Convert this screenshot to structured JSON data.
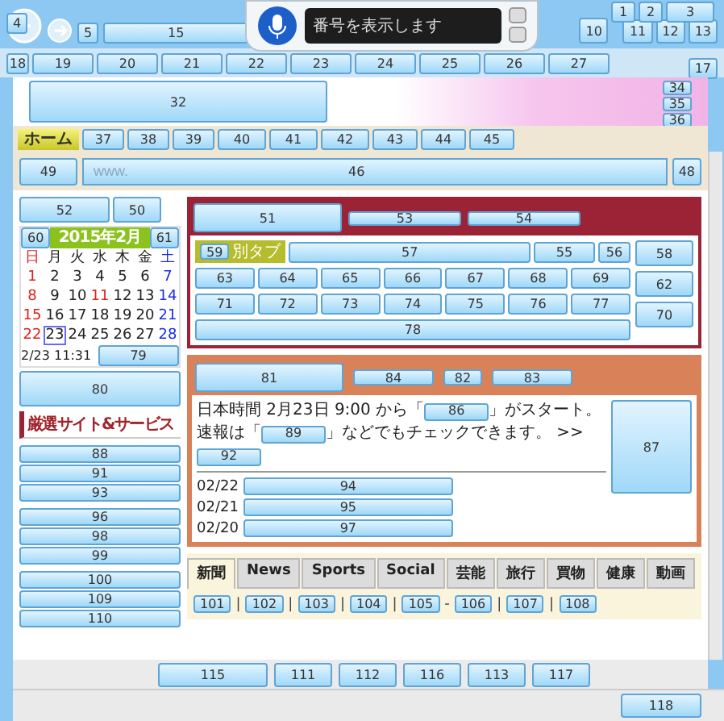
{
  "speech": {
    "status": "番号を表示します"
  },
  "window_tags": [
    "1",
    "2",
    "3"
  ],
  "nav": {
    "back_tag": "4",
    "small_tag": "5",
    "address_tag": "15",
    "tab_tag": "10",
    "right_tags": [
      "11",
      "12",
      "13"
    ]
  },
  "favorites": [
    "18",
    "19",
    "20",
    "21",
    "22",
    "23",
    "24",
    "25",
    "26",
    "27"
  ],
  "favorites_end_tag": "17",
  "header": {
    "banner_tag": "32",
    "side_tags": [
      "34",
      "35",
      "36"
    ]
  },
  "menu": {
    "home": "ホーム",
    "tags": [
      "37",
      "38",
      "39",
      "40",
      "41",
      "42",
      "43",
      "44",
      "45"
    ]
  },
  "url_row": {
    "select_tag": "49",
    "placeholder": "www.",
    "url_tag": "46",
    "go_tag": "48"
  },
  "left": {
    "shop_tags": [
      "52",
      "50"
    ],
    "calendar": {
      "title": "2015年2月",
      "prev_tag": "60",
      "next_tag": "61",
      "weekdays": [
        {
          "label": "日",
          "kind": "sunday"
        },
        {
          "label": "月",
          "kind": "weekday"
        },
        {
          "label": "火",
          "kind": "weekday"
        },
        {
          "label": "水",
          "kind": "weekday"
        },
        {
          "label": "木",
          "kind": "weekday"
        },
        {
          "label": "金",
          "kind": "weekday"
        },
        {
          "label": "土",
          "kind": "saturday"
        }
      ],
      "weeks": [
        [
          {
            "day": "1",
            "kind": "sunday",
            "selected": false
          },
          {
            "day": "2",
            "kind": "weekday",
            "selected": false
          },
          {
            "day": "3",
            "kind": "weekday",
            "selected": false
          },
          {
            "day": "4",
            "kind": "weekday",
            "selected": false
          },
          {
            "day": "5",
            "kind": "weekday",
            "selected": false
          },
          {
            "day": "6",
            "kind": "weekday",
            "selected": false
          },
          {
            "day": "7",
            "kind": "saturday",
            "selected": false
          }
        ],
        [
          {
            "day": "8",
            "kind": "sunday",
            "selected": false
          },
          {
            "day": "9",
            "kind": "weekday",
            "selected": false
          },
          {
            "day": "10",
            "kind": "weekday",
            "selected": false
          },
          {
            "day": "11",
            "kind": "holiday",
            "selected": false
          },
          {
            "day": "12",
            "kind": "weekday",
            "selected": false
          },
          {
            "day": "13",
            "kind": "weekday",
            "selected": false
          },
          {
            "day": "14",
            "kind": "saturday",
            "selected": false
          }
        ],
        [
          {
            "day": "15",
            "kind": "sunday",
            "selected": false
          },
          {
            "day": "16",
            "kind": "weekday",
            "selected": false
          },
          {
            "day": "17",
            "kind": "weekday",
            "selected": false
          },
          {
            "day": "18",
            "kind": "weekday",
            "selected": false
          },
          {
            "day": "19",
            "kind": "weekday",
            "selected": false
          },
          {
            "day": "20",
            "kind": "weekday",
            "selected": false
          },
          {
            "day": "21",
            "kind": "saturday",
            "selected": false
          }
        ],
        [
          {
            "day": "22",
            "kind": "sunday",
            "selected": false
          },
          {
            "day": "23",
            "kind": "weekday",
            "selected": true
          },
          {
            "day": "24",
            "kind": "weekday",
            "selected": false
          },
          {
            "day": "25",
            "kind": "weekday",
            "selected": false
          },
          {
            "day": "26",
            "kind": "weekday",
            "selected": false
          },
          {
            "day": "27",
            "kind": "weekday",
            "selected": false
          },
          {
            "day": "28",
            "kind": "saturday",
            "selected": false
          }
        ]
      ],
      "clock": "2/23 11:31",
      "clock_tag": "79"
    },
    "mail_tag": "80",
    "section_title": "厳選サイト&サービス",
    "service_groups": [
      [
        "88",
        "91",
        "93"
      ],
      [
        "96",
        "98",
        "99"
      ],
      [
        "100",
        "109",
        "110"
      ]
    ]
  },
  "search": {
    "title_tag": "51",
    "header_tags": [
      "53",
      "54"
    ],
    "tab_label": "別タブ",
    "tab_tag": "59",
    "input_tag": "57",
    "button_tags": [
      "55",
      "56"
    ],
    "link_rows": [
      [
        "63",
        "64",
        "65",
        "66",
        "67",
        "68",
        "69"
      ],
      [
        "71",
        "72",
        "73",
        "74",
        "75",
        "76",
        "77"
      ]
    ],
    "side_tags": [
      "58",
      "62",
      "70"
    ],
    "topics_tag": "78"
  },
  "today": {
    "title_tag": "81",
    "header_tags": [
      "84",
      "82",
      "83"
    ],
    "paragraph": [
      {
        "kind": "text",
        "text": "日本時間 2月23日 9:00 から「"
      },
      {
        "kind": "link",
        "text": "86"
      },
      {
        "kind": "text",
        "text": "」がスタート。速報は「"
      },
      {
        "kind": "link",
        "text": "89"
      },
      {
        "kind": "text",
        "text": "」などでもチェックできます。 >>"
      },
      {
        "kind": "link",
        "text": "92"
      }
    ],
    "image_tag": "87",
    "news": [
      {
        "date": "02/22",
        "tag": "94"
      },
      {
        "date": "02/21",
        "tag": "95"
      },
      {
        "date": "02/20",
        "tag": "97"
      }
    ]
  },
  "tabs": [
    {
      "label": "新聞",
      "selected": true
    },
    {
      "label": "News",
      "selected": false
    },
    {
      "label": "Sports",
      "selected": false
    },
    {
      "label": "Social",
      "selected": false
    },
    {
      "label": "芸能",
      "selected": false
    },
    {
      "label": "旅行",
      "selected": false
    },
    {
      "label": "買物",
      "selected": false
    },
    {
      "label": "健康",
      "selected": false
    },
    {
      "label": "動画",
      "selected": false
    }
  ],
  "tab_links": [
    {
      "tag": "101",
      "sep": "|"
    },
    {
      "tag": "102",
      "sep": "|"
    },
    {
      "tag": "103",
      "sep": "|"
    },
    {
      "tag": "104",
      "sep": "|"
    },
    {
      "tag": "105",
      "sep": "-"
    },
    {
      "tag": "106",
      "sep": "|"
    },
    {
      "tag": "107",
      "sep": "|"
    },
    {
      "tag": "108"
    }
  ],
  "bottom_tags": [
    "115",
    "111",
    "112",
    "116",
    "113",
    "117"
  ],
  "status_tag": "118"
}
